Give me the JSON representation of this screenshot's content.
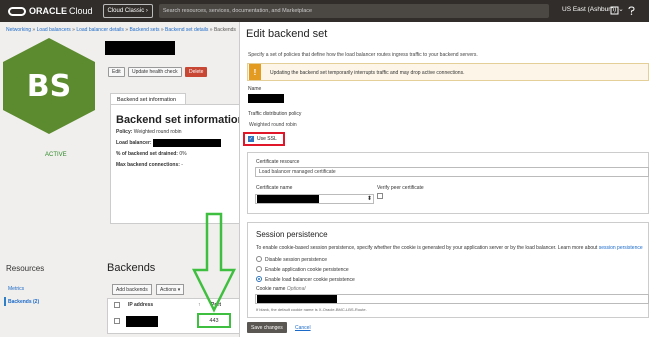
{
  "topbar": {
    "brand": "ORACLE",
    "brand_sub": "Cloud",
    "classic_btn": "Cloud Classic",
    "classic_chevron": "›",
    "search_placeholder": "Search resources, services, documentation, and Marketplace",
    "region": "US East (Ashburn)",
    "region_chevron": "⌄"
  },
  "breadcrumb": {
    "items": [
      "Networking",
      "Load balancers",
      "Load balancer details",
      "Backend sets",
      "Backend set details",
      "Backends"
    ],
    "sep": " » "
  },
  "badge": {
    "initials": "BS",
    "status": "ACTIVE"
  },
  "actions": {
    "edit": "Edit",
    "update_health": "Update health check",
    "delete": "Delete"
  },
  "info": {
    "tab": "Backend set information",
    "title": "Backend set information",
    "policy_label": "Policy:",
    "policy_value": "Weighted round robin",
    "lb_label": "Load balancer:",
    "drained_label": "% of backend set drained:",
    "drained_value": "0%",
    "max_conn_label": "Max backend connections:",
    "max_conn_value": "-"
  },
  "resources": {
    "title": "Resources",
    "metrics": "Metrics",
    "backends": "Backends (2)"
  },
  "backends": {
    "title": "Backends",
    "add_btn": "Add backends",
    "actions_btn": "Actions",
    "col_ip": "IP address",
    "sort_glyph": "↑",
    "col_port": "Port",
    "row_port": "443"
  },
  "panel": {
    "title": "Edit backend set",
    "desc": "Specify a set of policies that define how the load balancer routes ingress traffic to your backend servers.",
    "warning_icon": "!",
    "warning": "Updating the backend set temporarily interrupts traffic and may drop active connections.",
    "name_label": "Name",
    "policy_label": "Traffic distribution policy",
    "policy_value": "Weighted round robin",
    "use_ssl": "Use SSL",
    "check_glyph": "✓",
    "cert_resource_label": "Certificate resource",
    "cert_resource_value": "Load balancer managed certificate",
    "cert_name_label": "Certificate name",
    "verify_peer_label": "Verify peer certificate",
    "stepper_glyph": "⬍",
    "session_title": "Session persistence",
    "session_desc": "To enable cookie-based session persistence, specify whether the cookie is generated by your application server or by the load balancer. Learn more about",
    "session_link": "session persistence",
    "opt_disable": "Disable session persistence",
    "opt_app": "Enable application cookie persistence",
    "opt_lb": "Enable load balancer cookie persistence",
    "cookie_label": "Cookie name",
    "cookie_optional": "Optional",
    "cookie_help": "If blank, the default cookie name is X-Oracle-BMC-LBS-Route.",
    "save": "Save changes",
    "cancel": "Cancel"
  },
  "colors": {
    "topbar": "#312d2a",
    "hex_green": "#5b8b2e",
    "delete_red": "#c74634",
    "annotation_green": "#3fbf3f",
    "annotation_red": "#e0162b",
    "link_blue": "#1b6ac9"
  },
  "icons": [
    "notifications-icon",
    "help-icon"
  ]
}
